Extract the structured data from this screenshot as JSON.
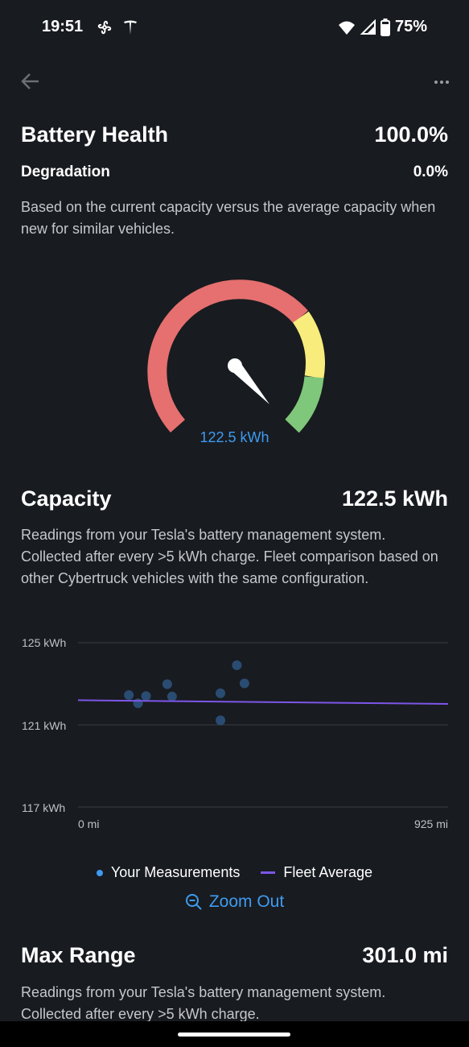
{
  "status_bar": {
    "time": "19:51",
    "battery": "75%"
  },
  "battery_health": {
    "title": "Battery Health",
    "value": "100.0%",
    "degradation_label": "Degradation",
    "degradation_value": "0.0%",
    "description": "Based on the current capacity versus the average capacity when new for similar vehicles.",
    "gauge_value": "122.5 kWh",
    "gauge_colors": {
      "red": "#e5706f",
      "yellow": "#f7ec7c",
      "green": "#7fc77a"
    }
  },
  "capacity": {
    "title": "Capacity",
    "value": "122.5 kWh",
    "description": "Readings from your Tesla's battery management system. Collected after every >5 kWh charge. Fleet comparison based on other Cybertruck vehicles with the same configuration."
  },
  "chart_data": {
    "type": "scatter",
    "y_ticks": [
      "125 kWh",
      "121 kWh",
      "117 kWh"
    ],
    "x_ticks": [
      "0 mi",
      "925 mi"
    ],
    "xlim": [
      0,
      925
    ],
    "ylim": [
      117,
      125
    ],
    "series": [
      {
        "name": "Your Measurements",
        "color": "#2a4c72",
        "points": [
          {
            "x": 127,
            "y": 122.45
          },
          {
            "x": 150,
            "y": 122.05
          },
          {
            "x": 170,
            "y": 122.4
          },
          {
            "x": 223,
            "y": 122.98
          },
          {
            "x": 235,
            "y": 122.38
          },
          {
            "x": 356,
            "y": 122.54
          },
          {
            "x": 356,
            "y": 121.22
          },
          {
            "x": 397,
            "y": 123.9
          },
          {
            "x": 416,
            "y": 123.02
          }
        ]
      },
      {
        "name": "Fleet Average",
        "color": "#7d56e8",
        "line": [
          {
            "x": 0,
            "y": 122.2
          },
          {
            "x": 925,
            "y": 122.02
          }
        ]
      }
    ]
  },
  "legend": {
    "measurements": "Your Measurements",
    "fleet": "Fleet Average"
  },
  "zoom_out_label": "Zoom Out",
  "max_range": {
    "title": "Max Range",
    "value": "301.0 mi",
    "description": "Readings from your Tesla's battery management system. Collected after every >5 kWh charge."
  }
}
